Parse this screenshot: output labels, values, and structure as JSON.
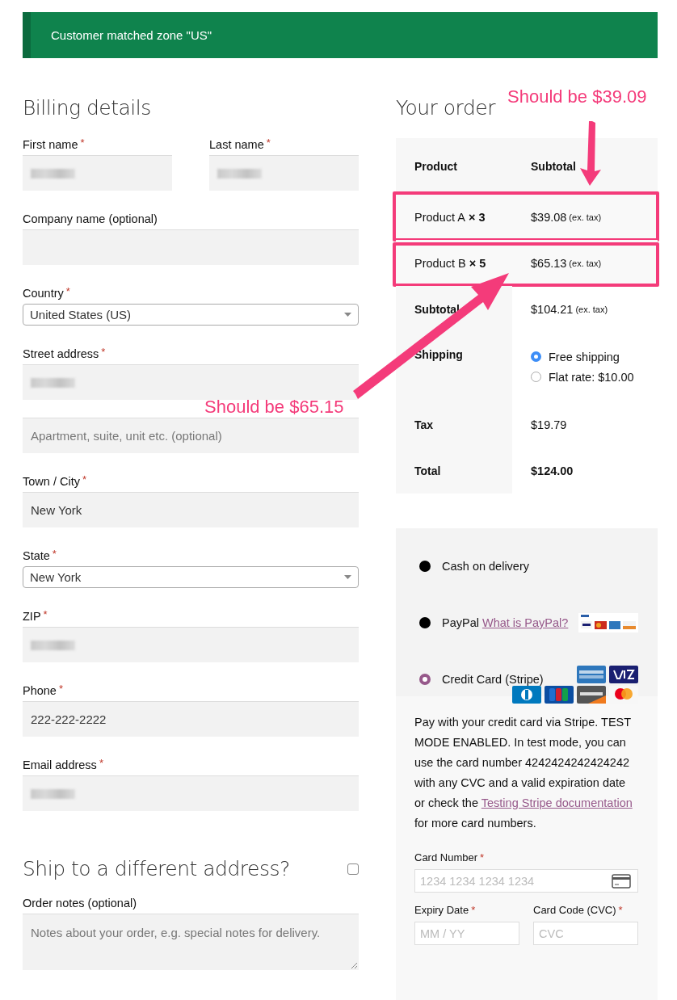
{
  "notice": "Customer matched zone \"US\"",
  "billing": {
    "title": "Billing details",
    "rows": [
      [
        {
          "label": "First name",
          "required_mark": "*",
          "kind": "input",
          "redacted": true
        },
        {
          "label": "Last name",
          "required_mark": "*",
          "kind": "input",
          "redacted": true
        }
      ],
      [
        {
          "label": "Company name (optional)",
          "kind": "input"
        }
      ],
      [
        {
          "label": "Country",
          "required_mark": "*",
          "kind": "select",
          "value": "United States (US)"
        }
      ],
      [
        {
          "label": "Street address",
          "required_mark": "*",
          "kind": "input",
          "redacted": true
        }
      ],
      [
        {
          "kind": "input",
          "placeholder": "Apartment, suite, unit etc. (optional)"
        }
      ],
      [
        {
          "label": "Town / City",
          "required_mark": "*",
          "kind": "input",
          "value": "New York"
        }
      ],
      [
        {
          "label": "State",
          "required_mark": "*",
          "kind": "select",
          "value": "New York"
        }
      ],
      [
        {
          "label": "ZIP",
          "required_mark": "*",
          "kind": "input",
          "redacted": true
        }
      ],
      [
        {
          "label": "Phone",
          "required_mark": "*",
          "kind": "input",
          "value": "222-222-2222"
        }
      ],
      [
        {
          "label": "Email address",
          "required_mark": "*",
          "kind": "input",
          "redacted": true
        }
      ]
    ]
  },
  "ship_different": {
    "title": "Ship to a different address?",
    "checked": false
  },
  "notes": {
    "label": "Order notes (optional)",
    "placeholder": "Notes about your order, e.g. special notes for delivery."
  },
  "order": {
    "title": "Your order",
    "columns": [
      "Product",
      "Subtotal"
    ],
    "items": [
      {
        "name": "Product A",
        "qty": "× 3",
        "price": "$39.08",
        "suffix": "(ex. tax)",
        "highlighted": true
      },
      {
        "name": "Product B",
        "qty": "× 5",
        "price": "$65.13",
        "suffix": "(ex. tax)",
        "highlighted": true
      }
    ],
    "subtotal": {
      "label": "Subtotal",
      "value": "$104.21",
      "suffix": "(ex. tax)"
    },
    "shipping": {
      "label": "Shipping",
      "options": [
        {
          "label": "Free shipping",
          "selected": true
        },
        {
          "label": "Flat rate: $10.00",
          "selected": false
        }
      ]
    },
    "tax": {
      "label": "Tax",
      "value": "$19.79"
    },
    "total": {
      "label": "Total",
      "value": "$124.00"
    }
  },
  "payment": {
    "methods": [
      {
        "label": "Cash on delivery",
        "selected": false
      },
      {
        "label": "PayPal",
        "link": "What is PayPal?",
        "kind": "paypal",
        "selected": false
      },
      {
        "label": "Credit Card (Stripe)",
        "kind": "cards",
        "selected": true
      }
    ],
    "description": {
      "before": "Pay with your credit card via Stripe. TEST MODE ENABLED. In test mode, you can use the card number 4242424242424242 with any CVC and a valid expiration date or check the",
      "link": "Testing Stripe documentation",
      "after": "for more card numbers."
    },
    "card_fields": [
      {
        "label": "Card Number",
        "required_mark": "*",
        "placeholder": "1234 1234 1234 1234",
        "kind": "number"
      },
      {
        "label": "Expiry Date",
        "required_mark": "*",
        "placeholder": "MM / YY",
        "kind": "expiry"
      },
      {
        "label": "Card Code (CVC)",
        "required_mark": "*",
        "placeholder": "CVC",
        "kind": "cvc"
      }
    ]
  },
  "annotations": [
    {
      "text": "Should be $39.09"
    },
    {
      "text": "Should be $65.15"
    }
  ]
}
